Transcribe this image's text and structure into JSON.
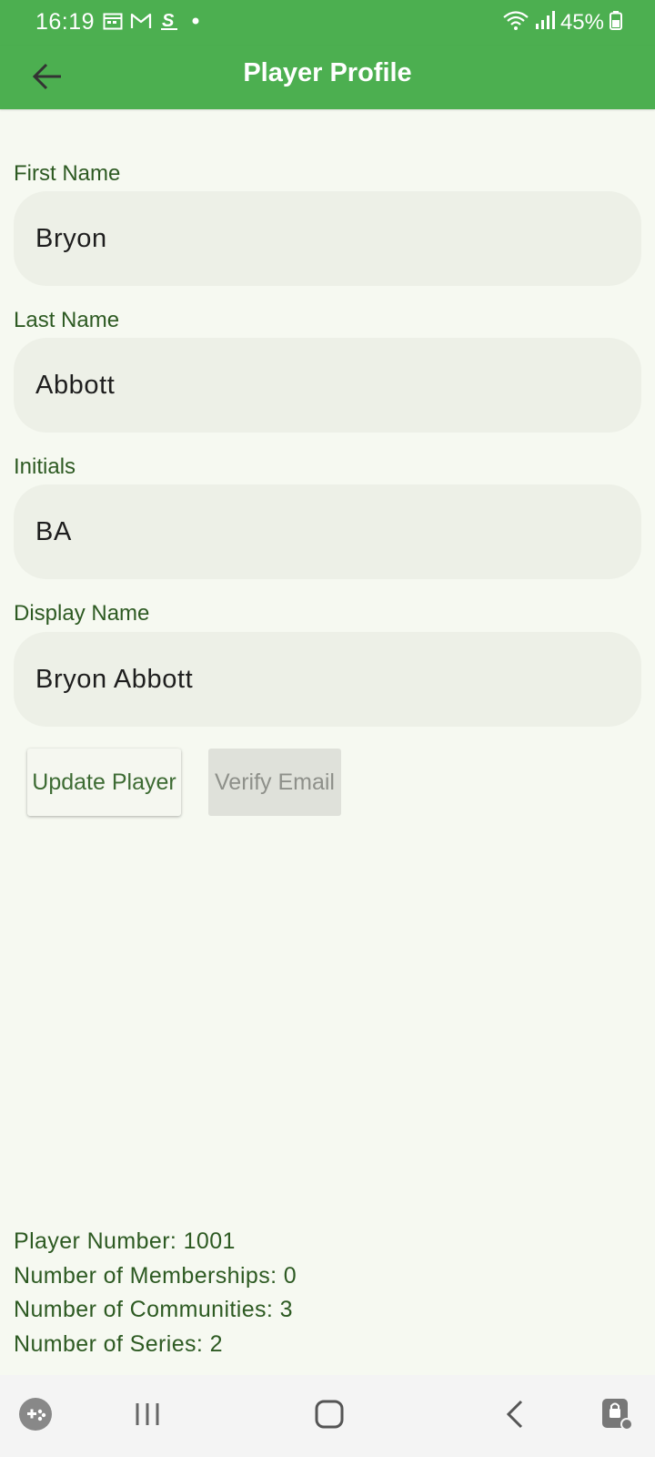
{
  "status_bar": {
    "time": "16:19",
    "battery": "45%",
    "left_icons": [
      "calendar-icon",
      "gmail-icon",
      "app-s-icon",
      "dot-icon"
    ],
    "right_icons": [
      "wifi-icon",
      "signal-icon",
      "battery-icon"
    ]
  },
  "app_bar": {
    "title": "Player Profile",
    "back_icon": "arrow-left-icon",
    "color": "#4caf50"
  },
  "form": {
    "first_name": {
      "label": "First Name",
      "value": "Bryon"
    },
    "last_name": {
      "label": "Last Name",
      "value": "Abbott"
    },
    "initials": {
      "label": "Initials",
      "value": "BA"
    },
    "display_name": {
      "label": "Display Name",
      "value": "Bryon Abbott"
    }
  },
  "buttons": {
    "update_player": "Update Player",
    "verify_email": "Verify Email"
  },
  "info": {
    "player_number": "Player Number: 1001",
    "memberships": "Number of Memberships: 0",
    "communities": "Number of Communities: 3",
    "series": "Number of Series: 2"
  },
  "nav_bar": {
    "items": [
      "game-launcher-icon",
      "recent-apps-icon",
      "home-icon",
      "back-icon",
      "screen-lock-icon"
    ]
  },
  "colors": {
    "primary": "#4caf50",
    "label": "#2d5a22",
    "field_bg": "#edf0e7",
    "page_bg": "#f6f9f1"
  }
}
